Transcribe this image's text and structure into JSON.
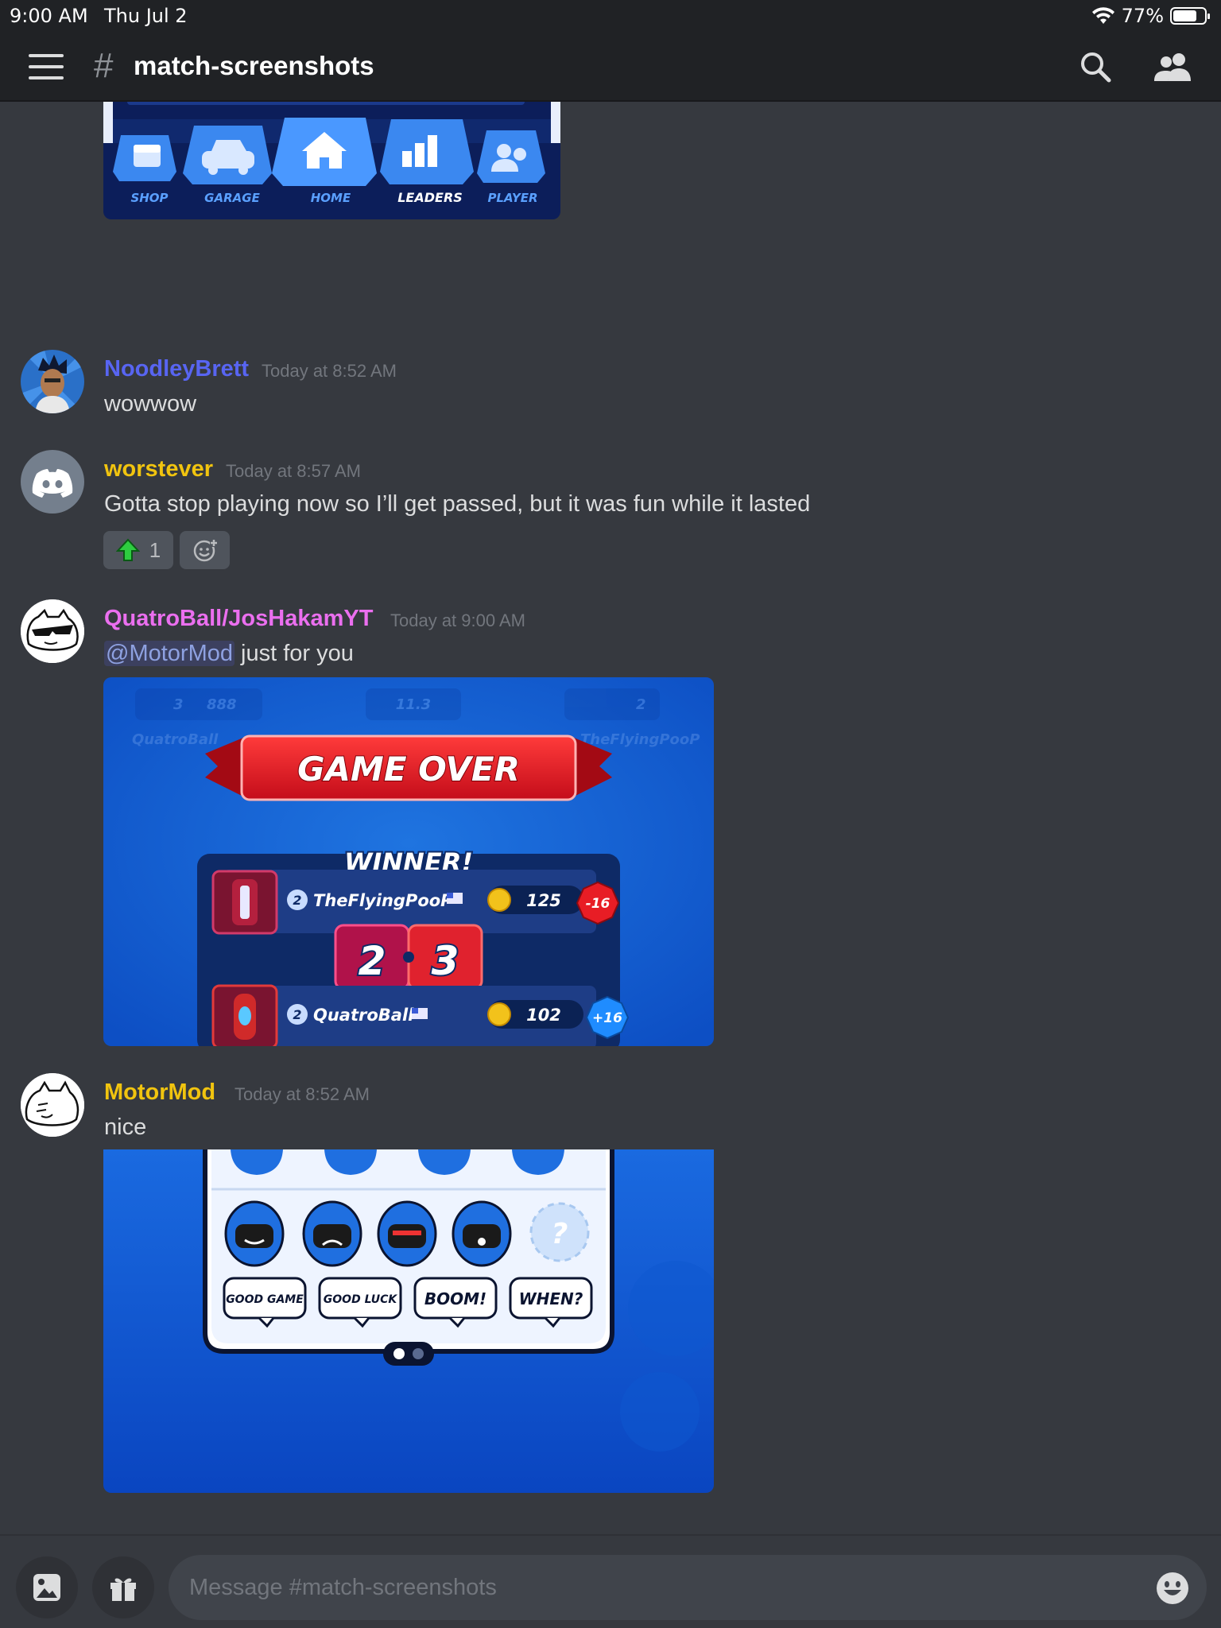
{
  "status_bar": {
    "time": "9:00 AM",
    "date": "Thu Jul 2",
    "battery": "77%",
    "battery_level": 0.77
  },
  "header": {
    "hash": "#",
    "channel": "match-screenshots"
  },
  "top_attachment": {
    "nav": [
      "SHOP",
      "GARAGE",
      "HOME",
      "LEADERS",
      "PLAYER"
    ]
  },
  "messages": [
    {
      "username": "NoodleyBrett",
      "user_color": "#5865f2",
      "timestamp": "Today at 8:52 AM",
      "text": "wowwow"
    },
    {
      "username": "worstever",
      "user_color": "#f1c40f",
      "timestamp": "Today at 8:57 AM",
      "text": "Gotta stop playing now so I’ll get passed, but it was fun while it lasted",
      "reaction_count": "1"
    },
    {
      "username": "QuatroBall/JosHakamYT",
      "user_color": "#eb6fef",
      "timestamp": "Today at 9:00 AM",
      "mention": "@MotorMod",
      "text": " just for you"
    },
    {
      "username": "MotorMod",
      "user_color": "#f1c40f",
      "timestamp": "Today at 8:52 AM",
      "text": "nice"
    }
  ],
  "game_over": {
    "banner": "GAME OVER",
    "winner_label": "WINNER!",
    "player1": {
      "name": "TheFlyingPooP",
      "level": "2",
      "coins": "125",
      "delta": "-16"
    },
    "player2": {
      "name": "QuatroBall",
      "level": "2",
      "coins": "102",
      "delta": "+16"
    },
    "score_left": "2",
    "score_right": "3",
    "faded_header": {
      "left_value": "3",
      "left_number": "888",
      "timer": "11.3",
      "right_value": "2",
      "left_name": "QuatroBall",
      "right_name": "TheFlyingPooP"
    }
  },
  "emotes": {
    "chips": [
      "GOOD GAME",
      "GOOD LUCK",
      "BOOM!",
      "WHEN?"
    ],
    "placeholder_icon": "?"
  },
  "composer": {
    "placeholder": "Message #match-screenshots"
  }
}
